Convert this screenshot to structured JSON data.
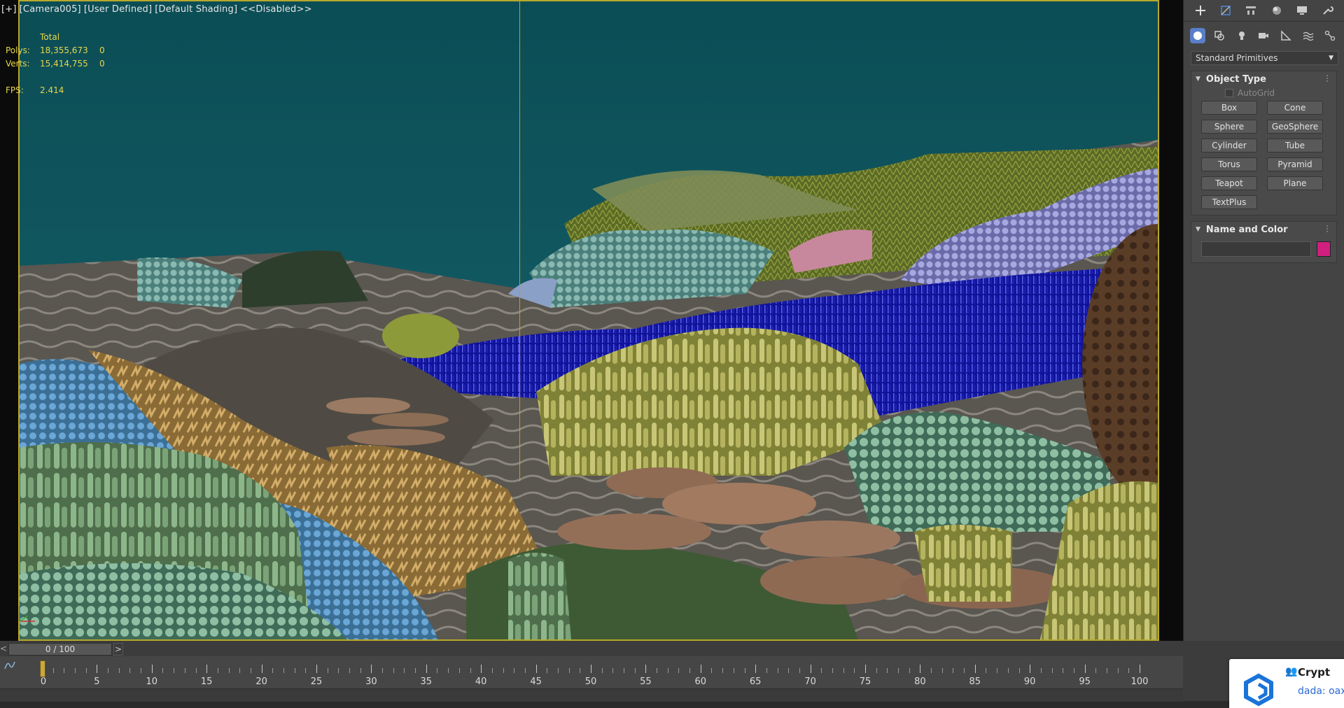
{
  "viewport": {
    "label_parts": [
      "[+]",
      "[Camera005]",
      "[User Defined]",
      "[Default Shading]",
      "<<Disabled>>"
    ],
    "stats": {
      "header": "Total",
      "polys_label": "Polys:",
      "polys_total": "18,355,673",
      "polys_sel": "0",
      "verts_label": "Verts:",
      "verts_total": "15,414,755",
      "verts_sel": "0",
      "fps_label": "FPS:",
      "fps_value": "2.414"
    }
  },
  "command_panel": {
    "top_tabs": [
      "create-tab-icon",
      "modify-tab-icon",
      "hierarchy-tab-icon",
      "motion-tab-icon",
      "display-tab-icon",
      "utilities-tab-icon"
    ],
    "categories": [
      "geometry-icon",
      "shapes-icon",
      "lights-icon",
      "cameras-icon",
      "helpers-icon",
      "space-warps-icon",
      "systems-icon"
    ],
    "category_dropdown": "Standard Primitives",
    "object_type": {
      "title": "Object Type",
      "autogrid_label": "AutoGrid",
      "buttons": [
        "Box",
        "Cone",
        "Sphere",
        "GeoSphere",
        "Cylinder",
        "Tube",
        "Torus",
        "Pyramid",
        "Teapot",
        "Plane",
        "TextPlus"
      ]
    },
    "name_and_color": {
      "title": "Name and Color",
      "name_value": "",
      "color": "#d11f7f"
    }
  },
  "timeline": {
    "slider_label": "0 / 100",
    "prev_label": "<",
    "next_label": ">",
    "start": 0,
    "end": 100,
    "current_frame": 0,
    "labels": [
      "0",
      "5",
      "10",
      "15",
      "20",
      "25",
      "30",
      "35",
      "40",
      "45",
      "50",
      "55",
      "60",
      "65",
      "70",
      "75",
      "80",
      "85",
      "90",
      "95",
      "100"
    ]
  },
  "toast": {
    "title": "Crypt",
    "subtitle": "dada: oax"
  }
}
